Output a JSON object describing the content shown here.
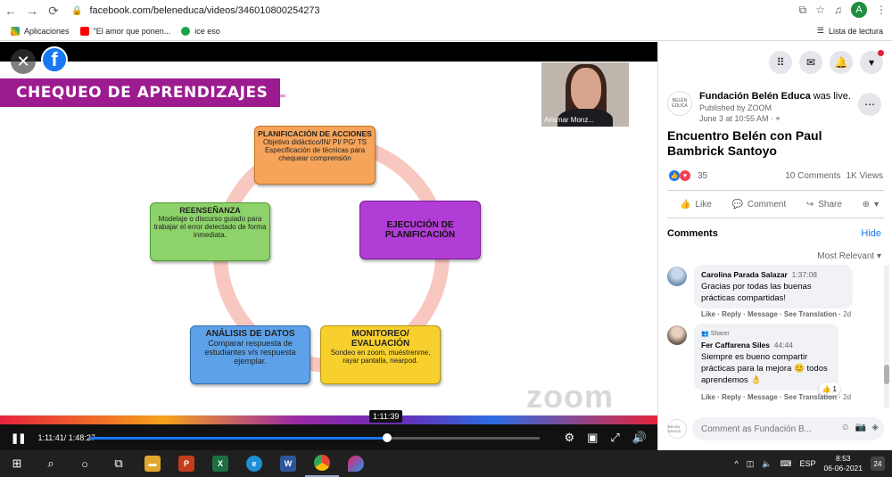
{
  "browser": {
    "url": "facebook.com/beleneduca/videos/346010800254273",
    "bookmarks": [
      "Aplicaciones",
      "\"El amor que ponen...",
      "ice eso"
    ],
    "reading_list": "Lista de lectura",
    "profile_initial": "A"
  },
  "slide": {
    "title": "CHEQUEO DE APRENDIZAJES",
    "plan_title": "PLANIFICACIÓN DE ACCIONES",
    "plan_text": "Objetivo didáctico/IN/ PI/ PG/ TS Especificación de técnicas para chequear comprensión",
    "ejec_title": "EJECUCIÓN DE PLANIFICACIÓN",
    "moni_title": "MONITOREO/ EVALUACIÓN",
    "moni_text": "Sondeo en zoom, muéstrenme, rayar pantalla, nearpod.",
    "anal_title": "ANÁLISIS DE DATOS",
    "anal_text": "Comparar respuesta de estudiantes v/s respuesta ejemplar.",
    "reen_title": "REENSEÑANZA",
    "reen_text": "Modelaje o discurso guiado para trabajar el error detectado de forma inmediata.",
    "watermark": "zoom",
    "cam_name": "Arismar Monz..."
  },
  "player": {
    "time": "1:11:41/ 1:48:27",
    "tooltip": "1:11:39",
    "progress": 0.661
  },
  "post": {
    "page_name": "Fundación Belén Educa",
    "status": " was live.",
    "published_by": "Published by ZOOM",
    "date": "June 3 at 10:55 AM · ⌖",
    "title": "Encuentro Belén con Paul Bambrick Santoyo",
    "reactions": "35",
    "comments_count": "10 Comments",
    "views": "1K Views",
    "like": "Like",
    "comment": "Comment",
    "share": "Share",
    "logo_text": "BELÉN EDUCA"
  },
  "comments": {
    "header": "Comments",
    "hide": "Hide",
    "sort": "Most Relevant",
    "items": [
      {
        "name": "Carolina Parada Salazar",
        "time": "1:37:08",
        "text": "Gracias por todas las buenas prácticas compartidas!",
        "meta": "Like · Reply · Message · See Translation · ",
        "age": "2d"
      },
      {
        "badge": "Sharer",
        "name": "Fer Caffarena Siles",
        "time": "44:44",
        "text": "Siempre es bueno compartir prácticas para la mejora 😊 todos aprendemos 👌",
        "reactions": "1",
        "meta": "Like · Reply · Message · See Translation · ",
        "age": "2d"
      }
    ],
    "compose_placeholder": "Comment as Fundación B..."
  },
  "taskbar": {
    "lang": "ESP",
    "time": "8:53",
    "date": "06-06-2021",
    "notifications": "24"
  }
}
